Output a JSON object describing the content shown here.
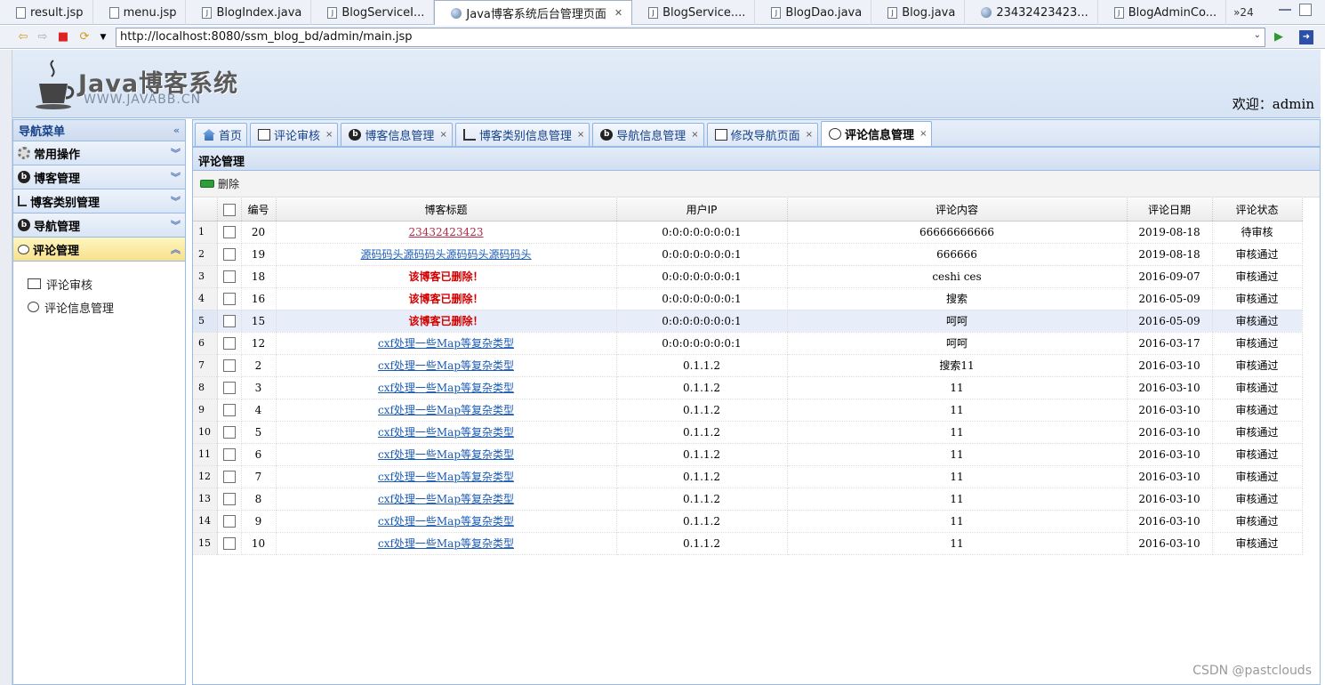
{
  "editor_tabs": [
    {
      "label": "result.jsp",
      "icon": "file-icon",
      "active": false
    },
    {
      "label": "menu.jsp",
      "icon": "file-icon",
      "active": false
    },
    {
      "label": "BlogIndex.java",
      "icon": "java-file-icon",
      "active": false
    },
    {
      "label": "BlogServiceI...",
      "icon": "java-file-icon",
      "active": false
    },
    {
      "label": "Java博客系统后台管理页面",
      "icon": "globe-icon",
      "active": true
    },
    {
      "label": "BlogService....",
      "icon": "java-file-icon",
      "active": false
    },
    {
      "label": "BlogDao.java",
      "icon": "java-file-icon",
      "active": false
    },
    {
      "label": "Blog.java",
      "icon": "java-file-icon",
      "active": false
    },
    {
      "label": "23432423423...",
      "icon": "globe-icon",
      "active": false
    },
    {
      "label": "BlogAdminCo...",
      "icon": "java-file-icon",
      "active": false
    }
  ],
  "editor_tabs_more": "»24",
  "address_bar": {
    "url": "http://localhost:8080/ssm_blog_bd/admin/main.jsp"
  },
  "header": {
    "logo_title": "Java博客系统",
    "logo_subtitle": "WWW.JAVABB.CN",
    "welcome": "欢迎：admin"
  },
  "left_menu": {
    "title": "导航菜单",
    "sections": [
      {
        "label": "常用操作",
        "icon": "gear-icon"
      },
      {
        "label": "博客管理",
        "icon": "blog-icon"
      },
      {
        "label": "博客类别管理",
        "icon": "tree-icon"
      },
      {
        "label": "导航管理",
        "icon": "blog-icon"
      },
      {
        "label": "评论管理",
        "icon": "comment-icon",
        "open": true
      }
    ],
    "open_items": [
      {
        "label": "评论审核",
        "icon": "review-icon"
      },
      {
        "label": "评论信息管理",
        "icon": "bubble-icon"
      }
    ]
  },
  "content_tabs": [
    {
      "label": "首页",
      "icon": "home-icon",
      "closable": false
    },
    {
      "label": "评论审核",
      "icon": "review-icon",
      "closable": true
    },
    {
      "label": "博客信息管理",
      "icon": "blog-icon",
      "closable": true
    },
    {
      "label": "博客类别信息管理",
      "icon": "tree-icon",
      "closable": true
    },
    {
      "label": "导航信息管理",
      "icon": "blog-icon",
      "closable": true
    },
    {
      "label": "修改导航页面",
      "icon": "edit-icon",
      "closable": true
    },
    {
      "label": "评论信息管理",
      "icon": "bubble-icon",
      "closable": true,
      "active": true
    }
  ],
  "grid": {
    "title": "评论管理",
    "toolbar_delete": "删除",
    "columns": [
      "编号",
      "博客标题",
      "用户IP",
      "评论内容",
      "评论日期",
      "评论状态"
    ],
    "rows": [
      {
        "n": "1",
        "id": "20",
        "title": "23432423423",
        "type": "visited",
        "ip": "0:0:0:0:0:0:0:1",
        "content": "66666666666",
        "date": "2019-08-18",
        "status": "待审核"
      },
      {
        "n": "2",
        "id": "19",
        "title": "源码码头源码码头源码码头源码码头",
        "type": "link",
        "ip": "0:0:0:0:0:0:0:1",
        "content": "666666",
        "date": "2019-08-18",
        "status": "审核通过"
      },
      {
        "n": "3",
        "id": "18",
        "title": "该博客已删除！",
        "type": "deleted",
        "ip": "0:0:0:0:0:0:0:1",
        "content": "ceshi ces",
        "date": "2016-09-07",
        "status": "审核通过"
      },
      {
        "n": "4",
        "id": "16",
        "title": "该博客已删除！",
        "type": "deleted",
        "ip": "0:0:0:0:0:0:0:1",
        "content": "搜索",
        "date": "2016-05-09",
        "status": "审核通过"
      },
      {
        "n": "5",
        "id": "15",
        "title": "该博客已删除！",
        "type": "deleted",
        "ip": "0:0:0:0:0:0:0:1",
        "content": "呵呵",
        "date": "2016-05-09",
        "status": "审核通过",
        "highlight": true
      },
      {
        "n": "6",
        "id": "12",
        "title": "cxf处理一些Map等复杂类型",
        "type": "link",
        "ip": "0:0:0:0:0:0:0:1",
        "content": "呵呵",
        "date": "2016-03-17",
        "status": "审核通过"
      },
      {
        "n": "7",
        "id": "2",
        "title": "cxf处理一些Map等复杂类型",
        "type": "link",
        "ip": "0.1.1.2",
        "content": "搜索11",
        "date": "2016-03-10",
        "status": "审核通过"
      },
      {
        "n": "8",
        "id": "3",
        "title": "cxf处理一些Map等复杂类型",
        "type": "link",
        "ip": "0.1.1.2",
        "content": "11",
        "date": "2016-03-10",
        "status": "审核通过"
      },
      {
        "n": "9",
        "id": "4",
        "title": "cxf处理一些Map等复杂类型",
        "type": "link",
        "ip": "0.1.1.2",
        "content": "11",
        "date": "2016-03-10",
        "status": "审核通过"
      },
      {
        "n": "10",
        "id": "5",
        "title": "cxf处理一些Map等复杂类型",
        "type": "link",
        "ip": "0.1.1.2",
        "content": "11",
        "date": "2016-03-10",
        "status": "审核通过"
      },
      {
        "n": "11",
        "id": "6",
        "title": "cxf处理一些Map等复杂类型",
        "type": "link",
        "ip": "0.1.1.2",
        "content": "11",
        "date": "2016-03-10",
        "status": "审核通过"
      },
      {
        "n": "12",
        "id": "7",
        "title": "cxf处理一些Map等复杂类型",
        "type": "link",
        "ip": "0.1.1.2",
        "content": "11",
        "date": "2016-03-10",
        "status": "审核通过"
      },
      {
        "n": "13",
        "id": "8",
        "title": "cxf处理一些Map等复杂类型",
        "type": "link",
        "ip": "0.1.1.2",
        "content": "11",
        "date": "2016-03-10",
        "status": "审核通过"
      },
      {
        "n": "14",
        "id": "9",
        "title": "cxf处理一些Map等复杂类型",
        "type": "link",
        "ip": "0.1.1.2",
        "content": "11",
        "date": "2016-03-10",
        "status": "审核通过"
      },
      {
        "n": "15",
        "id": "10",
        "title": "cxf处理一些Map等复杂类型",
        "type": "link",
        "ip": "0.1.1.2",
        "content": "11",
        "date": "2016-03-10",
        "status": "审核通过"
      }
    ]
  },
  "watermark": "CSDN @pastclouds",
  "colors": {
    "link": "#1a5bb5",
    "visited_link": "#b5284a",
    "deleted": "#d40000",
    "panel_border": "#99bbe8"
  }
}
